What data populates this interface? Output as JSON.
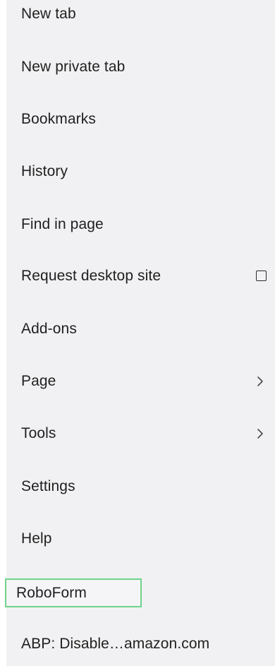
{
  "menu": {
    "items": [
      {
        "label": "New tab"
      },
      {
        "label": "New private tab"
      },
      {
        "label": "Bookmarks"
      },
      {
        "label": "History"
      },
      {
        "label": "Find in page"
      },
      {
        "label": "Request desktop site",
        "checked": false
      },
      {
        "label": "Add-ons"
      },
      {
        "label": "Page",
        "icon": "chevron-right-icon"
      },
      {
        "label": "Tools",
        "icon": "chevron-right-icon"
      },
      {
        "label": "Settings"
      },
      {
        "label": "Help"
      },
      {
        "label": "RoboForm",
        "highlighted": true,
        "highlight_color": "#6fd38a"
      },
      {
        "label": "ABP: Disable…amazon.com"
      }
    ]
  }
}
